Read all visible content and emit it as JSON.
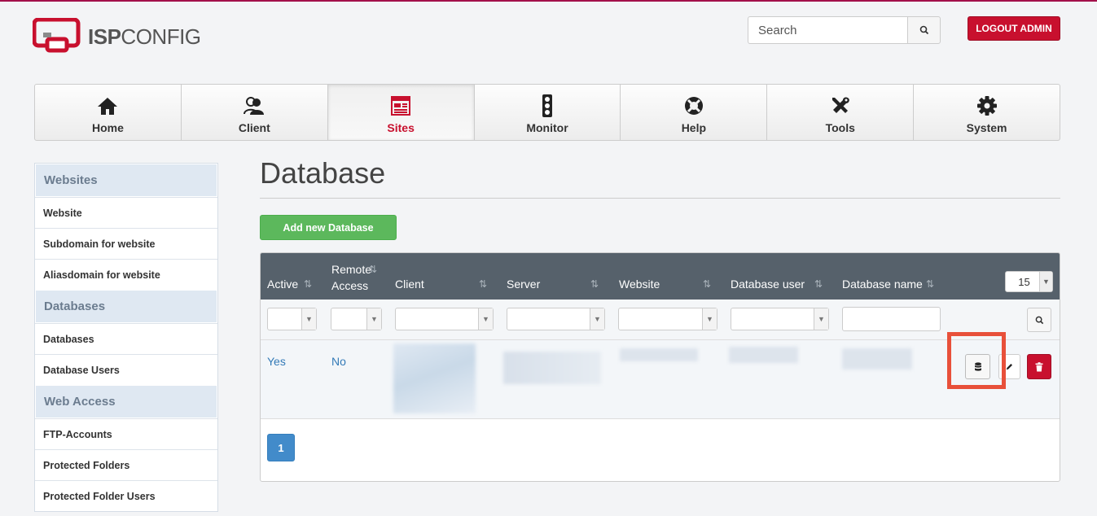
{
  "app": {
    "logo_isp": "ISP",
    "logo_config": "CONFIG"
  },
  "header": {
    "search_placeholder": "Search",
    "logout_label": "LOGOUT ADMIN"
  },
  "nav": [
    {
      "label": "Home",
      "icon": "home-icon"
    },
    {
      "label": "Client",
      "icon": "users-icon"
    },
    {
      "label": "Sites",
      "icon": "sites-icon",
      "active": true
    },
    {
      "label": "Monitor",
      "icon": "traffic-light-icon"
    },
    {
      "label": "Help",
      "icon": "lifebuoy-icon"
    },
    {
      "label": "Tools",
      "icon": "tools-icon"
    },
    {
      "label": "System",
      "icon": "gear-icon"
    }
  ],
  "sidebar": {
    "sections": [
      {
        "title": "Websites",
        "items": [
          "Website",
          "Subdomain for website",
          "Aliasdomain for website"
        ]
      },
      {
        "title": "Databases",
        "items": [
          "Databases",
          "Database Users"
        ]
      },
      {
        "title": "Web Access",
        "items": [
          "FTP-Accounts",
          "Protected Folders",
          "Protected Folder Users"
        ]
      }
    ]
  },
  "page": {
    "title": "Database",
    "add_button": "Add new Database"
  },
  "table": {
    "columns": [
      {
        "line1": "Active",
        "line2": ""
      },
      {
        "line1": "Remote",
        "line2": "Access"
      },
      {
        "line1": "Client",
        "line2": ""
      },
      {
        "line1": "Server",
        "line2": ""
      },
      {
        "line1": "Website",
        "line2": ""
      },
      {
        "line1": "Database user",
        "line2": ""
      },
      {
        "line1": "Database name",
        "line2": ""
      }
    ],
    "sort_glyph": "⇅",
    "per_page": "15",
    "rows": [
      {
        "active": "Yes",
        "remote_access": "No"
      }
    ],
    "pagination": [
      "1"
    ]
  },
  "colors": {
    "brand_red": "#c8102e",
    "accent_blue": "#337ab7",
    "add_green": "#5cb85c",
    "header_dark": "#56616b",
    "highlight": "#e8503a"
  }
}
